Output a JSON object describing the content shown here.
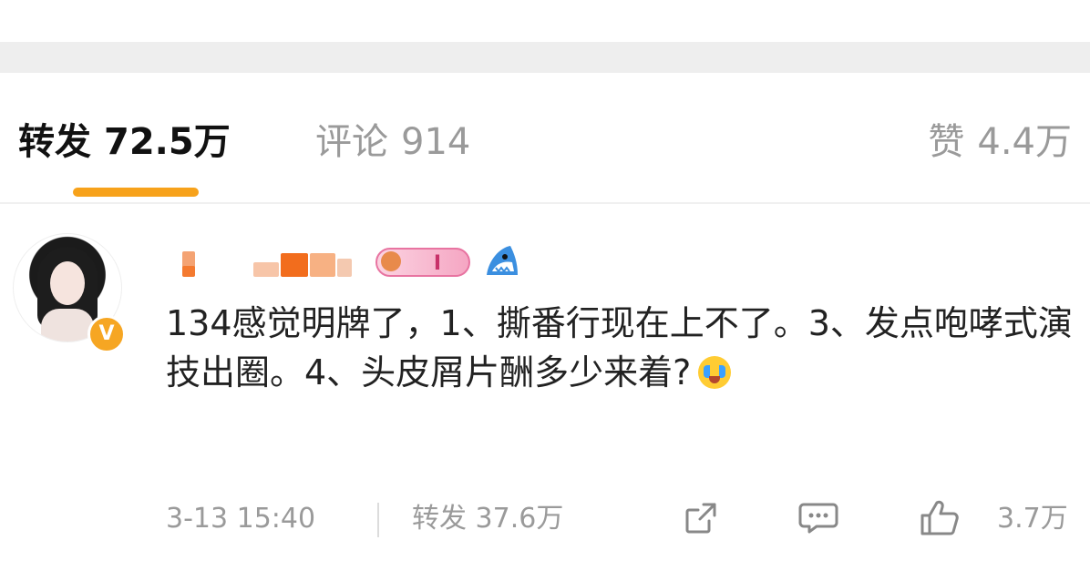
{
  "tabs": {
    "repost_label": "转发",
    "repost_count": "72.5万",
    "comment_label": "评论",
    "comment_count": "914",
    "like_label": "赞",
    "like_count": "4.4万"
  },
  "comment": {
    "medal_text": "I",
    "verified_badge": "V",
    "text": "134感觉明牌了，1、撕番行现在上不了。3、发点咆哮式演技出圈。4、头皮屑片酬多少来着?",
    "time": "3-13 15:40",
    "repost_label": "转发",
    "repost_count": "37.6万",
    "like_count": "3.7万"
  },
  "icons": {
    "verified": "verified-v-icon",
    "share": "share-icon",
    "comment": "comment-bubble-icon",
    "like": "thumbs-up-icon",
    "emoji": "crying-laughing-emoji-icon"
  },
  "colors": {
    "accent": "#f7a21b",
    "verified": "#f6a623",
    "muted_text": "#9a9a9a"
  }
}
